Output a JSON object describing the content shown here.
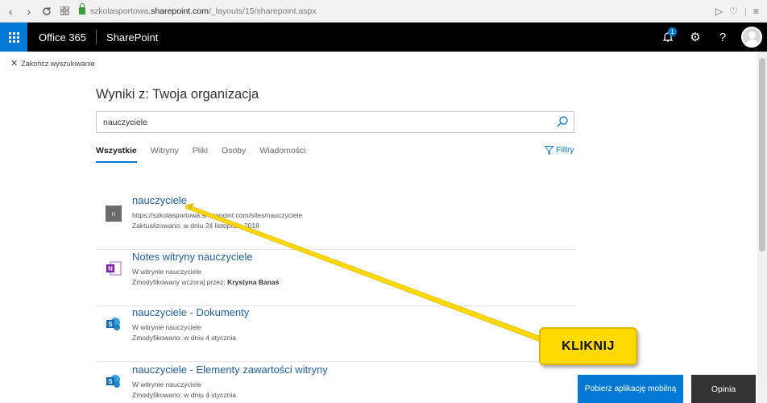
{
  "browser": {
    "back": "‹",
    "forward": "›",
    "reload": "C",
    "url_prefix": "szkolasportowa.",
    "url_host": "sharepoint.com",
    "url_path": "/_layouts/15/sharepoint.aspx"
  },
  "suite": {
    "product": "Office 365",
    "app": "SharePoint",
    "notification_count": "1",
    "gear": "⚙",
    "help": "?"
  },
  "end_search": {
    "icon": "✕",
    "label": "Zakończ wyszukiwanie"
  },
  "heading": "Wyniki z: Twoja organizacja",
  "search": {
    "value": "nauczyciele"
  },
  "tabs": [
    {
      "label": "Wszystkie",
      "active": true
    },
    {
      "label": "Witryny"
    },
    {
      "label": "Pliki"
    },
    {
      "label": "Osoby"
    },
    {
      "label": "Wiadomości"
    }
  ],
  "filters_label": "Filtry",
  "results": [
    {
      "icon": "site-icon",
      "icon_text": "n",
      "title": "nauczyciele",
      "line1": "https://szkolasportowa.sharepoint.com/sites/nauczyciele",
      "line2": "Zaktualizowano: w dniu 24 listopada 2018",
      "line2_bold": ""
    },
    {
      "icon": "onenote-icon",
      "title": "Notes witryny nauczyciele",
      "line1": "W witrynie nauczyciele",
      "line2": "Zmodyfikowany wczoraj przez: ",
      "line2_bold": "Krystyna Banaś"
    },
    {
      "icon": "sharepoint-icon",
      "title": "nauczyciele - Dokumenty",
      "line1": "W witrynie nauczyciele",
      "line2": "Zmodyfikowano: w dniu 4 stycznia",
      "line2_bold": ""
    },
    {
      "icon": "sharepoint-icon",
      "title": "nauczyciele - Elementy zawartości witryny",
      "line1": "W witrynie nauczyciele",
      "line2": "Zmodyfikowano: w dniu 4 stycznia",
      "line2_bold": ""
    }
  ],
  "callout": "KLIKNIJ",
  "mobile_button": "Pobierz aplikację mobilną",
  "feedback_button": "Opinia",
  "colors": {
    "accent": "#0078d4",
    "callout": "#ffd900",
    "title_link": "#215e9a"
  }
}
